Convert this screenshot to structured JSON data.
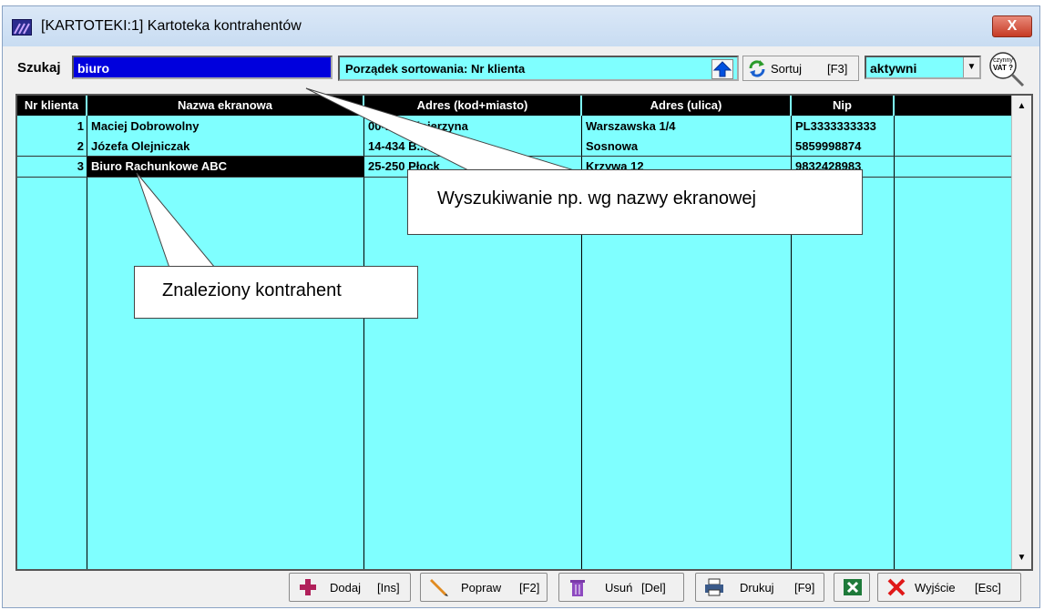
{
  "window": {
    "title": "[KARTOTEKI:1]  Kartoteka kontrahentów",
    "close_label": "X"
  },
  "toolbar": {
    "search_label": "Szukaj",
    "search_value": "biuro",
    "sort_label": "Porządek sortowania: Nr klienta",
    "sort_button_label": "Sortuj",
    "sort_button_key": "[F3]",
    "filter_value": "aktywni",
    "vat_line1": "czynny",
    "vat_line2": "VAT ?"
  },
  "table": {
    "columns": [
      "Nr klienta",
      "Nazwa ekranowa",
      "Adres (kod+miasto)",
      "Adres (ulica)",
      "Nip"
    ],
    "rows": [
      {
        "nr": "1",
        "name": "Maciej Dobrowolny",
        "city": "00-... Kościerzyna",
        "street": "Warszawska 1/4",
        "nip": "PL3333333333"
      },
      {
        "nr": "2",
        "name": "Józefa Olejniczak",
        "city": "14-434 B...",
        "street": "Sosnowa",
        "nip": "5859998874"
      },
      {
        "nr": "3",
        "name": "Biuro Rachunkowe ABC",
        "city": "25-250 Płock",
        "street": "Krzywa 12",
        "nip": "9832428983"
      }
    ],
    "selected_row": 3
  },
  "callouts": {
    "search_hint": "Wyszukiwanie np. wg nazwy ekranowej",
    "found_hint": "Znaleziony kontrahent"
  },
  "buttons": {
    "add": {
      "label": "Dodaj",
      "key": "[Ins]"
    },
    "edit": {
      "label": "Popraw",
      "key": "[F2]"
    },
    "delete": {
      "label": "Usuń",
      "key": "[Del]"
    },
    "print": {
      "label": "Drukuj",
      "key": "[F9]"
    },
    "exit": {
      "label": "Wyjście",
      "key": "[Esc]"
    }
  },
  "colors": {
    "grid_bg": "#7fffff",
    "search_bg": "#0000dd",
    "header_bg": "#000000"
  }
}
